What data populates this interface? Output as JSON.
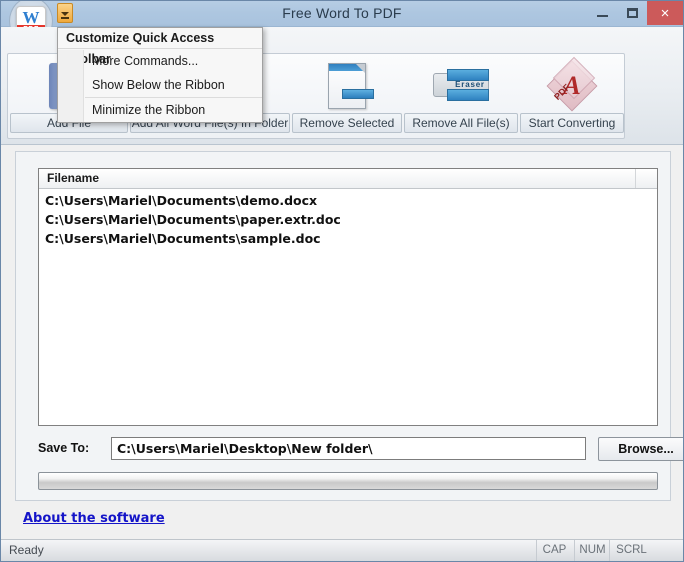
{
  "window": {
    "title": "Free Word To PDF",
    "controls": {
      "minimize": "minimize-icon",
      "maximize": "maximize-icon",
      "close": "×"
    }
  },
  "quick_access": {
    "logo_letter": "W",
    "logo_band": "PDF",
    "dropdown_icon": "chevron-down-icon"
  },
  "qat_menu": {
    "header": "Customize Quick Access Toolbar",
    "items": [
      {
        "label": "More Commands..."
      },
      {
        "label": "Show Below the Ribbon"
      },
      {
        "label": "Minimize the Ribbon"
      }
    ]
  },
  "ribbon": {
    "buttons": [
      {
        "label": "Add File",
        "icon": "word-document-icon"
      },
      {
        "label": "Add All Word File(s) In Folder",
        "icon": "folder-documents-icon"
      },
      {
        "label": "Remove Selected",
        "icon": "page-remove-icon"
      },
      {
        "label": "Remove All File(s)",
        "icon": "eraser-icon",
        "icon_text": "Eraser"
      },
      {
        "label": "Start Converting",
        "icon": "pdf-diamond-icon",
        "icon_text": "PDF"
      }
    ]
  },
  "file_list": {
    "column_header": "Filename",
    "rows": [
      "C:\\Users\\Mariel\\Documents\\demo.docx",
      "C:\\Users\\Mariel\\Documents\\paper.extr.doc",
      "C:\\Users\\Mariel\\Documents\\sample.doc"
    ]
  },
  "save_to": {
    "label": "Save To:",
    "value": "C:\\Users\\Mariel\\Desktop\\New folder\\",
    "browse_label": "Browse..."
  },
  "progress": {
    "percent": 0
  },
  "about": {
    "link_label": "About the software"
  },
  "status_bar": {
    "message": "Ready",
    "indicators": [
      "CAP",
      "NUM",
      "SCRL"
    ]
  },
  "colors": {
    "titlebar": "#adc6e0",
    "close_button": "#cc5a5a",
    "link": "#1414c8",
    "accent_orange": "#f0a93c"
  }
}
